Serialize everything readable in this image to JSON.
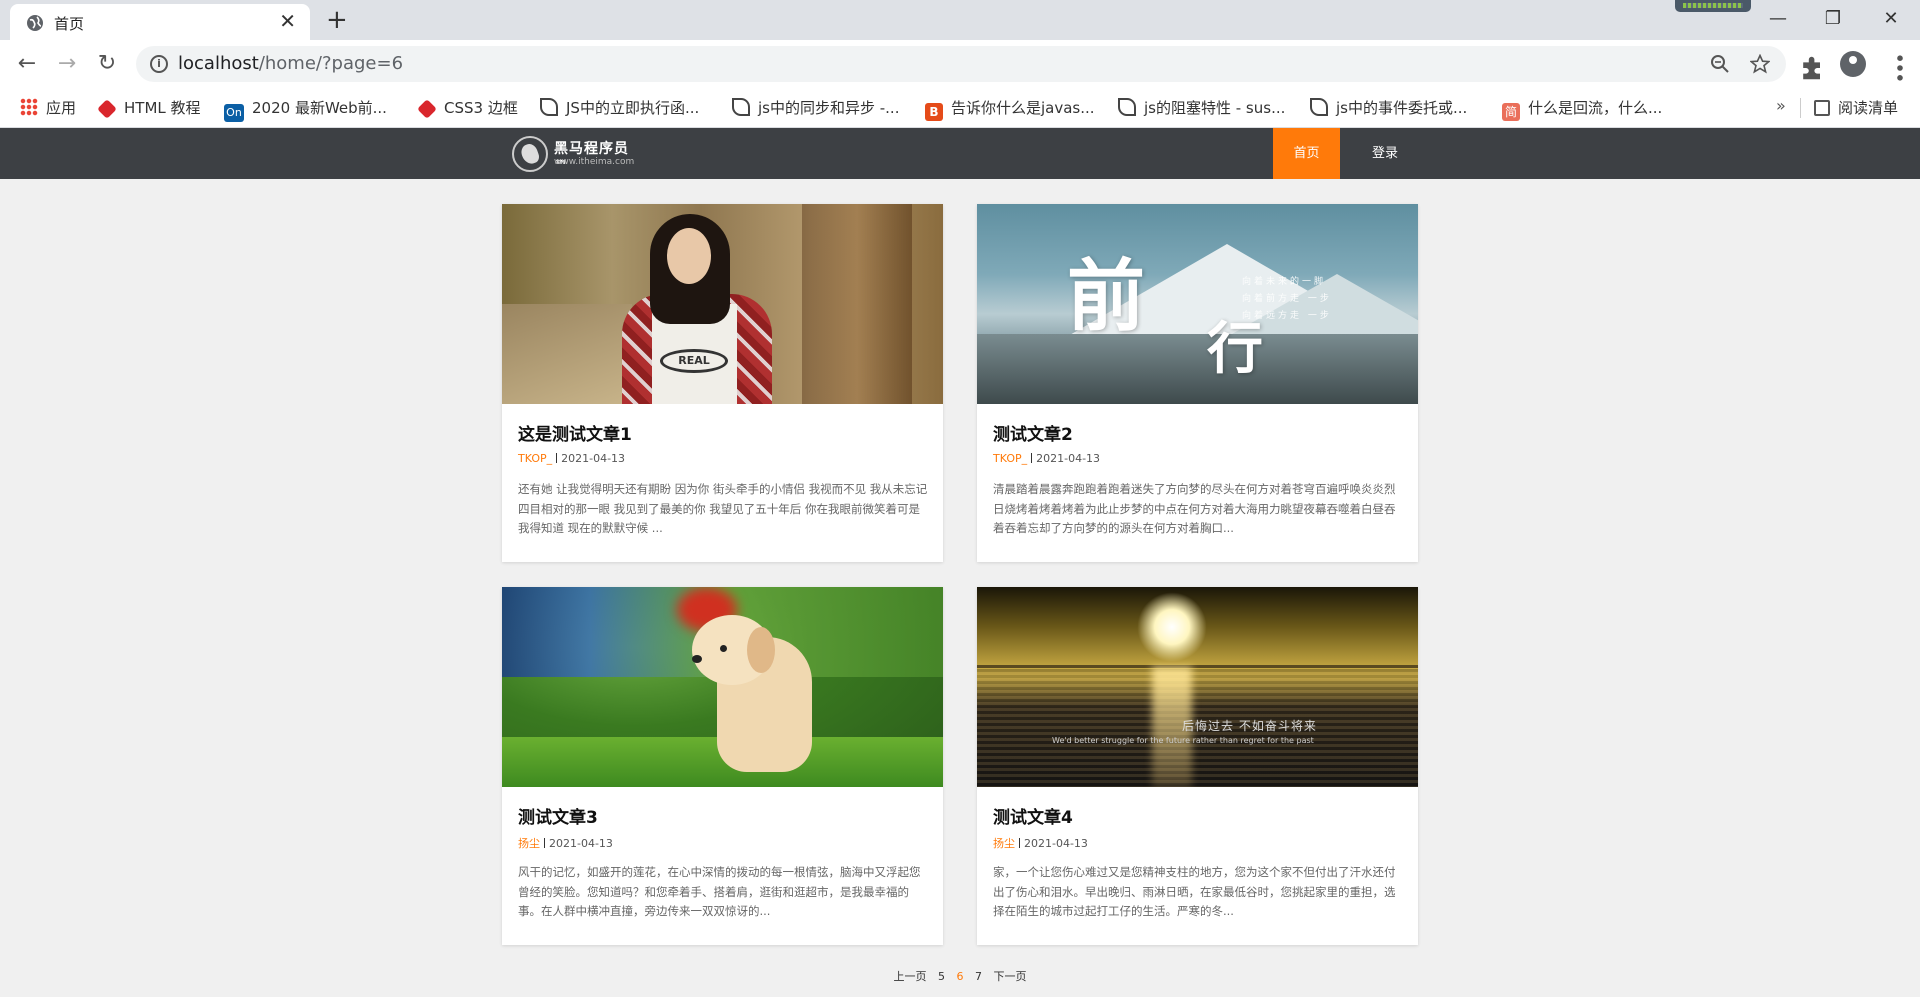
{
  "browser": {
    "tab": {
      "title": "首页",
      "close": "✕"
    },
    "new_tab": "+",
    "window_controls": {
      "minimize": "—",
      "maximize": "❐",
      "close": "✕"
    },
    "nav": {
      "back": "←",
      "forward": "→",
      "reload": "↻"
    },
    "url": {
      "host": "localhost",
      "path": "/home/?page=6"
    },
    "toolbar_icons": [
      "zoom-icon",
      "star-icon",
      "extension-icon",
      "profile-icon",
      "menu-icon"
    ],
    "bookmarks": [
      {
        "label": "应用",
        "icon": "apps-icon",
        "color": "#ea4335"
      },
      {
        "label": "HTML 教程",
        "icon": "runoob-icon",
        "color": "#d9262c"
      },
      {
        "label": "2020 最新Web前...",
        "icon": "on-icon",
        "color": "#0b5fa5"
      },
      {
        "label": "CSS3 边框",
        "icon": "runoob-icon",
        "color": "#d9262c"
      },
      {
        "label": "JS中的立即执行函...",
        "icon": "feather-icon",
        "color": "#444444"
      },
      {
        "label": "js中的同步和异步 -...",
        "icon": "feather-icon",
        "color": "#444444"
      },
      {
        "label": "告诉你什么是javas...",
        "icon": "b-icon",
        "color": "#e54b19"
      },
      {
        "label": "js的阻塞特性 - sus...",
        "icon": "feather-icon",
        "color": "#444444"
      },
      {
        "label": "js中的事件委托或...",
        "icon": "feather-icon",
        "color": "#444444"
      },
      {
        "label": "什么是回流，什么...",
        "icon": "jian-icon",
        "color": "#ea6f5a"
      }
    ],
    "bookmarks_more": "»",
    "reading_list": "阅读清单"
  },
  "site": {
    "logo": {
      "name": "黑马程序员™",
      "sub": "www.itheima.com"
    },
    "nav": {
      "home": "首页",
      "login": "登录"
    },
    "accent": "#ff7a0a",
    "header_bg": "#3d4044"
  },
  "articles": [
    {
      "title": "这是测试文章1",
      "author": "TKOP_",
      "date": "2021-04-13",
      "excerpt": "还有她 让我觉得明天还有期盼 因为你 街头牵手的小情侣 我视而不见 我从未忘记四目相对的那一眼 我见到了最美的你 我望见了五十年后 你在我眼前微笑着可是我得知道 现在的默默守候 ...",
      "image": "girl-photo"
    },
    {
      "title": "测试文章2",
      "author": "TKOP_",
      "date": "2021-04-13",
      "excerpt": "清晨踏着晨露奔跑跑着跑着迷失了方向梦的尽头在何方对着苍穹百遍呼唤炎炎烈日烧烤着烤着烤着为此止步梦的中点在何方对着大海用力眺望夜幕吞噬着白昼吞着吞着忘却了方向梦的的源头在何方对着胸口...",
      "image": "mountain-calligraphy",
      "image_text": {
        "main1": "前",
        "main2": "行",
        "poem": "向着未来的一脚\n向着前方走 一步\n向着远方走 一步"
      }
    },
    {
      "title": "测试文章3",
      "author": "扬尘",
      "date": "2021-04-13",
      "excerpt": "风干的记忆，如盛开的莲花，在心中深情的拨动的每一根情弦，脑海中又浮起您曾经的笑脸。您知道吗？和您牵着手、搭着肩，逛街和逛超市，是我最幸福的事。在人群中横冲直撞，旁边传来一双双惊讶的...",
      "image": "puppy-photo"
    },
    {
      "title": "测试文章4",
      "author": "扬尘",
      "date": "2021-04-13",
      "excerpt": "家，一个让您伤心难过又是您精神支柱的地方，您为这个家不但付出了汗水还付出了伤心和泪水。早出晚归、雨淋日晒，在家最低谷时，您挑起家里的重担，选择在陌生的城市过起打工仔的生活。严寒的冬...",
      "image": "sunset-sea",
      "image_text": {
        "cap1": "后悔过去  不如奋斗将来",
        "cap2": "We'd better struggle for the future rather than regret for the past"
      }
    }
  ],
  "pagination": {
    "prev": "上一页",
    "pages": [
      "5",
      "6",
      "7"
    ],
    "current": "6",
    "next": "下一页"
  }
}
